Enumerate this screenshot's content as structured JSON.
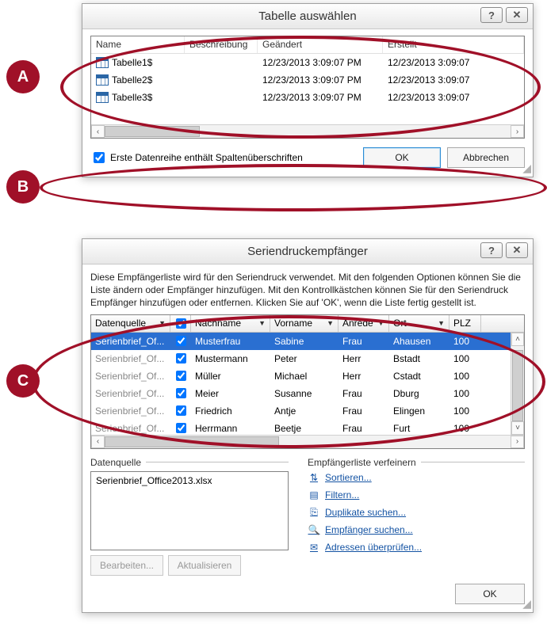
{
  "dialog1": {
    "title": "Tabelle auswählen",
    "headers": {
      "name": "Name",
      "desc": "Beschreibung",
      "modified": "Geändert",
      "created": "Erstellt"
    },
    "rows": [
      {
        "name": "Tabelle1$",
        "desc": "",
        "modified": "12/23/2013 3:09:07 PM",
        "created": "12/23/2013 3:09:07"
      },
      {
        "name": "Tabelle2$",
        "desc": "",
        "modified": "12/23/2013 3:09:07 PM",
        "created": "12/23/2013 3:09:07"
      },
      {
        "name": "Tabelle3$",
        "desc": "",
        "modified": "12/23/2013 3:09:07 PM",
        "created": "12/23/2013 3:09:07"
      }
    ],
    "checkbox_label": "Erste Datenreihe enthält Spaltenüberschriften",
    "checkbox_checked": true,
    "ok": "OK",
    "cancel": "Abbrechen"
  },
  "dialog2": {
    "title": "Seriendruckempfänger",
    "description": "Diese Empfängerliste wird für den Seriendruck verwendet. Mit den folgenden Optionen können Sie die Liste ändern oder Empfänger hinzufügen. Mit den Kontrollkästchen können Sie für den Seriendruck Empfänger hinzufügen oder entfernen. Klicken Sie auf 'OK', wenn die Liste fertig gestellt ist.",
    "columns": {
      "source": "Datenquelle",
      "checkbox": "",
      "lastname": "Nachname",
      "firstname": "Vorname",
      "salutation": "Anrede",
      "city": "Ort",
      "zip": "PLZ"
    },
    "rows": [
      {
        "source": "Serienbrief_Of...",
        "checked": true,
        "lastname": "Musterfrau",
        "firstname": "Sabine",
        "salutation": "Frau",
        "city": "Ahausen",
        "zip": "100"
      },
      {
        "source": "Serienbrief_Of...",
        "checked": true,
        "lastname": "Mustermann",
        "firstname": "Peter",
        "salutation": "Herr",
        "city": "Bstadt",
        "zip": "100"
      },
      {
        "source": "Serienbrief_Of...",
        "checked": true,
        "lastname": "Müller",
        "firstname": "Michael",
        "salutation": "Herr",
        "city": "Cstadt",
        "zip": "100"
      },
      {
        "source": "Serienbrief_Of...",
        "checked": true,
        "lastname": "Meier",
        "firstname": "Susanne",
        "salutation": "Frau",
        "city": "Dburg",
        "zip": "100"
      },
      {
        "source": "Serienbrief_Of...",
        "checked": true,
        "lastname": "Friedrich",
        "firstname": "Antje",
        "salutation": "Frau",
        "city": "Elingen",
        "zip": "100"
      },
      {
        "source": "Serienbrief_Of...",
        "checked": true,
        "lastname": "Herrmann",
        "firstname": "Beetje",
        "salutation": "Frau",
        "city": "Furt",
        "zip": "100"
      }
    ],
    "datasource_label": "Datenquelle",
    "datasource_item": "Serienbrief_Office2013.xlsx",
    "edit_btn": "Bearbeiten...",
    "refresh_btn": "Aktualisieren",
    "refine_label": "Empfängerliste verfeinern",
    "link_sort": "Sortieren...",
    "link_filter": "Filtern...",
    "link_dup": "Duplikate suchen...",
    "link_find": "Empfänger suchen...",
    "link_validate": "Adressen überprüfen...",
    "ok": "OK"
  },
  "annotations": {
    "a": "A",
    "b": "B",
    "c": "C"
  }
}
